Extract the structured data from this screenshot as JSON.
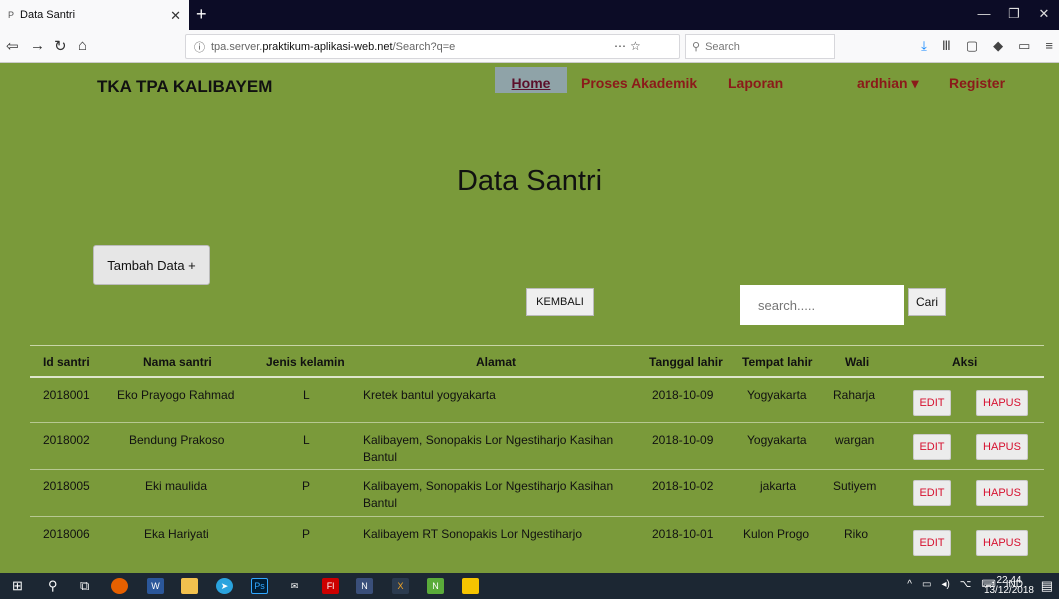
{
  "browser": {
    "tab_title": "Data Santri",
    "tab_icon": "P",
    "url_prefix": "tpa.server.",
    "url_domain": "praktikum-aplikasi-web.net",
    "url_path": "/Search?q=e",
    "search_placeholder": "Search"
  },
  "site": {
    "brand": "TKA TPA KALIBAYEM",
    "menu": {
      "home": "Home",
      "akademik": "Proses Akademik",
      "laporan": "Laporan",
      "user": "ardhian ▾",
      "register": "Register"
    }
  },
  "page": {
    "title": "Data Santri",
    "tambah_label": "Tambah Data +",
    "kembali_label": "KEMBALI",
    "search_placeholder": "search.....",
    "cari_label": "Cari"
  },
  "table": {
    "headers": [
      "Id santri",
      "Nama santri",
      "Jenis kelamin",
      "Alamat",
      "Tanggal lahir",
      "Tempat lahir",
      "Wali",
      "Aksi"
    ],
    "rows": [
      {
        "id": "2018001",
        "nama": "Eko Prayogo Rahmad",
        "jk": "L",
        "alamat": "Kretek bantul yogyakarta",
        "tgl": "2018-10-09",
        "tempat": "Yogyakarta",
        "wali": "Raharja"
      },
      {
        "id": "2018002",
        "nama": "Bendung Prakoso",
        "jk": "L",
        "alamat": "Kalibayem, Sonopakis Lor Ngestiharjo Kasihan Bantul",
        "tgl": "2018-10-09",
        "tempat": "Yogyakarta",
        "wali": "wargan"
      },
      {
        "id": "2018005",
        "nama": "Eki maulida",
        "jk": "P",
        "alamat": "Kalibayem, Sonopakis Lor Ngestiharjo Kasihan Bantul",
        "tgl": "2018-10-02",
        "tempat": "jakarta",
        "wali": "Sutiyem"
      },
      {
        "id": "2018006",
        "nama": "Eka Hariyati",
        "jk": "P",
        "alamat": "Kalibayem RT Sonopakis Lor Ngestiharjo",
        "tgl": "2018-10-01",
        "tempat": "Kulon Progo",
        "wali": "Riko"
      }
    ],
    "edit_label": "EDIT",
    "hapus_label": "HAPUS"
  },
  "taskbar": {
    "lang": "IND",
    "time": "22.44",
    "date": "13/12/2018"
  },
  "colors": {
    "page_bg": "#7a9a3a",
    "menu_link": "#8b1a1a",
    "action_text": "#d6102f"
  }
}
